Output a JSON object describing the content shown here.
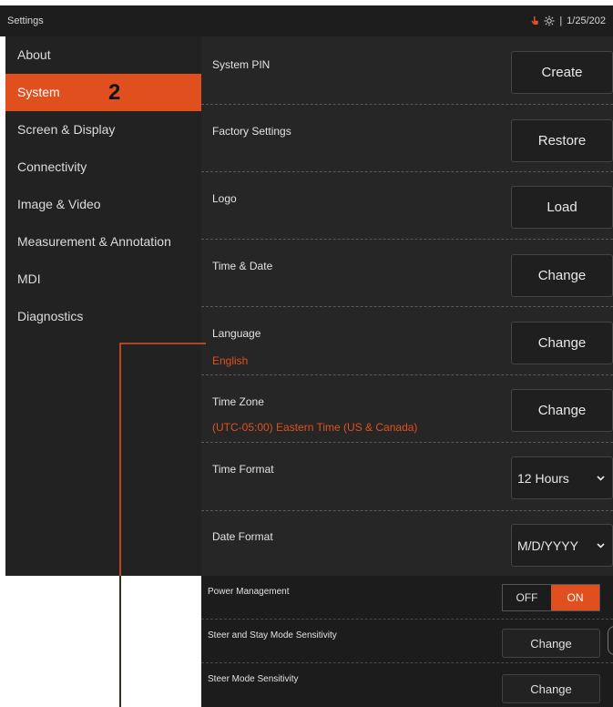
{
  "window": {
    "title": "Settings",
    "date": "1/25/202"
  },
  "sidebar": {
    "items": [
      {
        "label": "About"
      },
      {
        "label": "System"
      },
      {
        "label": "Screen & Display"
      },
      {
        "label": "Connectivity"
      },
      {
        "label": "Image & Video"
      },
      {
        "label": "Measurement & Annotation"
      },
      {
        "label": "MDI"
      },
      {
        "label": "Diagnostics"
      }
    ],
    "active_index": 1,
    "callout_number": "2"
  },
  "rows": [
    {
      "label": "System PIN",
      "button": "Create"
    },
    {
      "label": "Factory Settings",
      "button": "Restore"
    },
    {
      "label": "Logo",
      "button": "Load"
    },
    {
      "label": "Time & Date",
      "button": "Change"
    },
    {
      "label": "Language",
      "value": "English",
      "button": "Change"
    },
    {
      "label": "Time Zone",
      "value": "(UTC-05:00) Eastern Time (US & Canada)",
      "button": "Change"
    },
    {
      "label": "Time Format",
      "select": "12 Hours"
    },
    {
      "label": "Date Format",
      "select": "M/D/YYYY"
    }
  ],
  "lower_rows": [
    {
      "label": "Power Management",
      "off": "OFF",
      "on": "ON",
      "state": "on"
    },
    {
      "label": "Steer and Stay Mode Sensitivity",
      "button": "Change"
    },
    {
      "label": "Steer Mode Sensitivity",
      "button": "Change"
    }
  ],
  "colors": {
    "accent": "#e0501f",
    "panel": "#262626",
    "sidebar": "#222222"
  }
}
